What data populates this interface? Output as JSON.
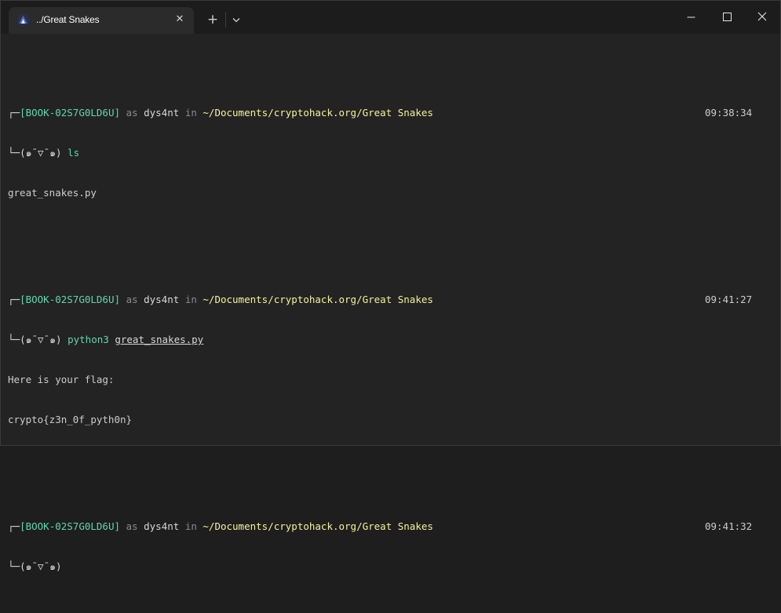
{
  "tab": {
    "title": "../Great Snakes",
    "close_glyph": "✕",
    "icon": "kali-dragon-icon"
  },
  "toolbar": {
    "new_tab_glyph": "+",
    "dropdown_glyph": "⌄"
  },
  "window_controls": {
    "minimize": "—",
    "maximize": "☐",
    "close": "✕"
  },
  "colors": {
    "prompt_green": "#5fd7af",
    "path_yellow": "#f5f29a",
    "muted_grey": "#8a8a8a",
    "text": "#cccccc",
    "background": "#232323"
  },
  "prompts": [
    {
      "corner": "┌─",
      "host": "[BOOK-02S7G0LD6U]",
      "as": "as",
      "user": "dys4nt",
      "in": "in",
      "path": "~/Documents/cryptohack.org/Great Snakes",
      "time": "09:38:34",
      "face_prefix": "└─",
      "face": "(๑¯▽¯๑)",
      "command": "ls",
      "argument": "",
      "output": [
        "great_snakes.py"
      ]
    },
    {
      "corner": "┌─",
      "host": "[BOOK-02S7G0LD6U]",
      "as": "as",
      "user": "dys4nt",
      "in": "in",
      "path": "~/Documents/cryptohack.org/Great Snakes",
      "time": "09:41:27",
      "face_prefix": "└─",
      "face": "(๑¯▽¯๑)",
      "command": "python3",
      "argument": "great_snakes.py",
      "output": [
        "Here is your flag:",
        "crypto{z3n_0f_pyth0n}"
      ]
    },
    {
      "corner": "┌─",
      "host": "[BOOK-02S7G0LD6U]",
      "as": "as",
      "user": "dys4nt",
      "in": "in",
      "path": "~/Documents/cryptohack.org/Great Snakes",
      "time": "09:41:32",
      "face_prefix": "└─",
      "face": "(๑¯▽¯๑)",
      "command": "",
      "argument": "",
      "output": []
    }
  ]
}
